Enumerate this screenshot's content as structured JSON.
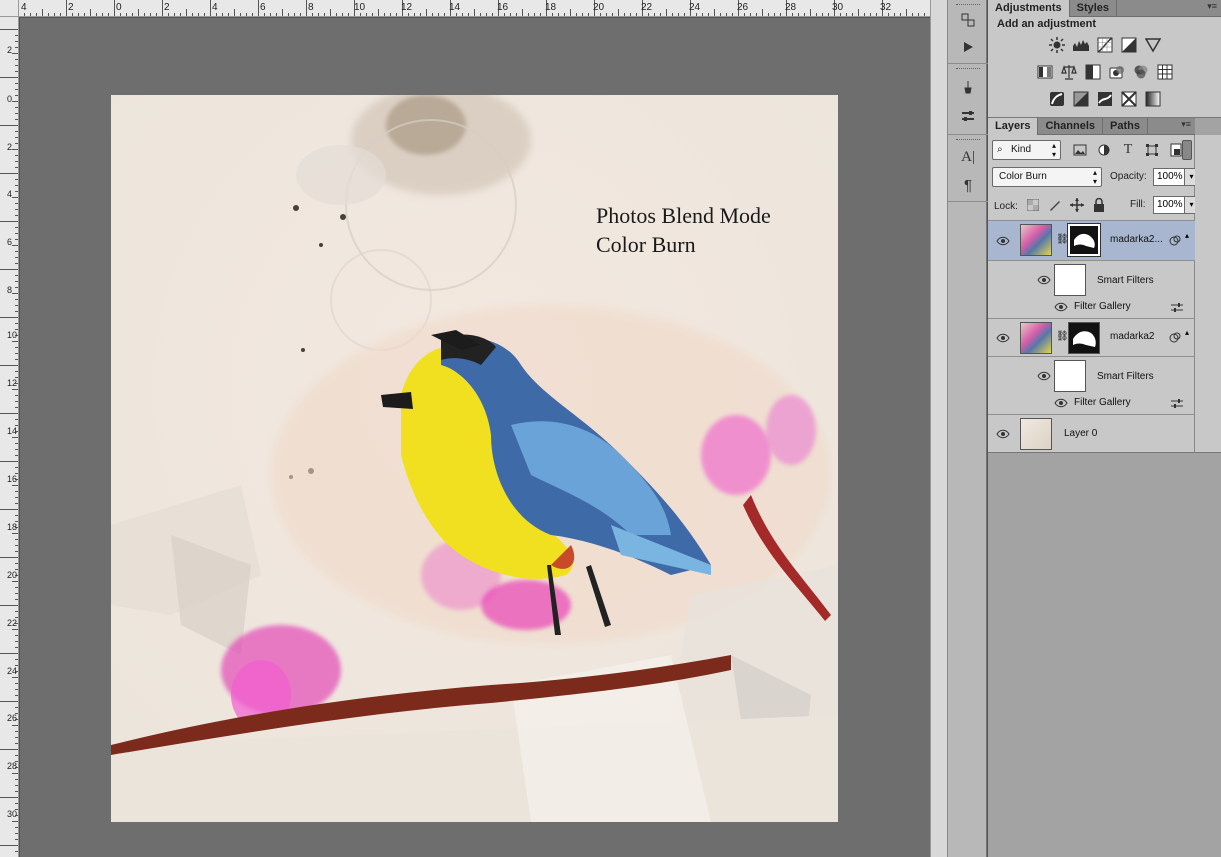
{
  "rulers": {
    "top_labels": [
      "4",
      "2",
      "0",
      "2",
      "4",
      "6",
      "8",
      "10",
      "12",
      "14",
      "16",
      "18",
      "20",
      "22",
      "24",
      "26",
      "28",
      "30",
      "32"
    ],
    "left_labels": [
      "2",
      "0",
      "2",
      "4",
      "6",
      "8",
      "10",
      "12",
      "14",
      "16",
      "18",
      "20",
      "22",
      "24",
      "26",
      "28",
      "30"
    ]
  },
  "document": {
    "text_line1": "Photos Blend Mode",
    "text_line2": "Color Burn"
  },
  "adjustments_panel": {
    "tabs": [
      "Adjustments",
      "Styles"
    ],
    "title": "Add an adjustment",
    "icons_row1": [
      "brightness-contrast-icon",
      "levels-icon",
      "curves-icon",
      "exposure-icon",
      "vibrance-icon"
    ],
    "icons_row2": [
      "hue-saturation-icon",
      "color-balance-icon",
      "black-white-icon",
      "photo-filter-icon",
      "channel-mixer-icon",
      "color-lookup-icon"
    ],
    "icons_row3": [
      "invert-icon",
      "posterize-icon",
      "threshold-icon",
      "selective-color-icon",
      "gradient-map-icon"
    ]
  },
  "layers_panel": {
    "tabs": [
      "Layers",
      "Channels",
      "Paths"
    ],
    "filter_kind": "Kind",
    "blend_mode": "Color Burn",
    "opacity_label": "Opacity:",
    "opacity_value": "100%",
    "lock_label": "Lock:",
    "fill_label": "Fill:",
    "fill_value": "100%",
    "layers": [
      {
        "name": "madarka2...",
        "smart_filters": "Smart Filters",
        "filter": "Filter Gallery",
        "selected": true
      },
      {
        "name": "madarka2",
        "smart_filters": "Smart Filters",
        "filter": "Filter Gallery",
        "selected": false
      },
      {
        "name": "Layer 0",
        "selected": false
      }
    ]
  },
  "colors": {
    "canvas_bg": "#6e6e6e",
    "panel_bg": "#c8c8c8",
    "selected_layer": "#a8b7cf"
  }
}
